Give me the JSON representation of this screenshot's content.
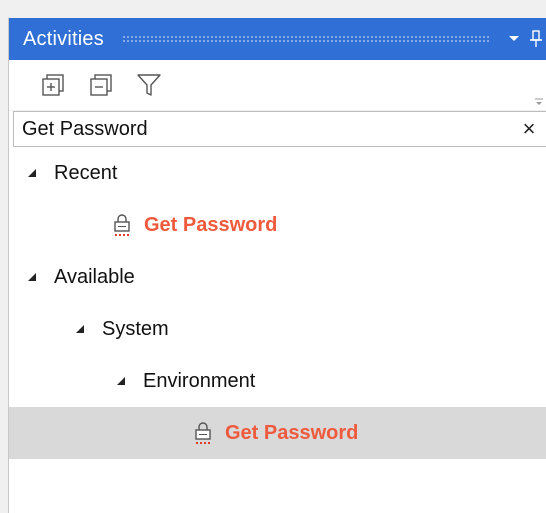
{
  "panel": {
    "title": "Activities",
    "title_bg": "#2f6fd6",
    "dropdown_icon": "chevron-down-icon",
    "pin_icon": "pin-icon"
  },
  "toolbar": {
    "expand_icon": "expand-all-icon",
    "collapse_icon": "collapse-all-icon",
    "filter_icon": "filter-icon"
  },
  "search": {
    "value": "Get Password",
    "clear_glyph": "×"
  },
  "tree": {
    "recent": {
      "label": "Recent",
      "items": [
        {
          "label": "Get Password",
          "icon": "lock-icon"
        }
      ]
    },
    "available": {
      "label": "Available",
      "system": {
        "label": "System",
        "environment": {
          "label": "Environment",
          "items": [
            {
              "label": "Get Password",
              "icon": "lock-icon",
              "selected": true
            }
          ]
        }
      }
    }
  },
  "colors": {
    "activity_text": "#f05a3c",
    "selection_bg": "#d9d9d9"
  }
}
